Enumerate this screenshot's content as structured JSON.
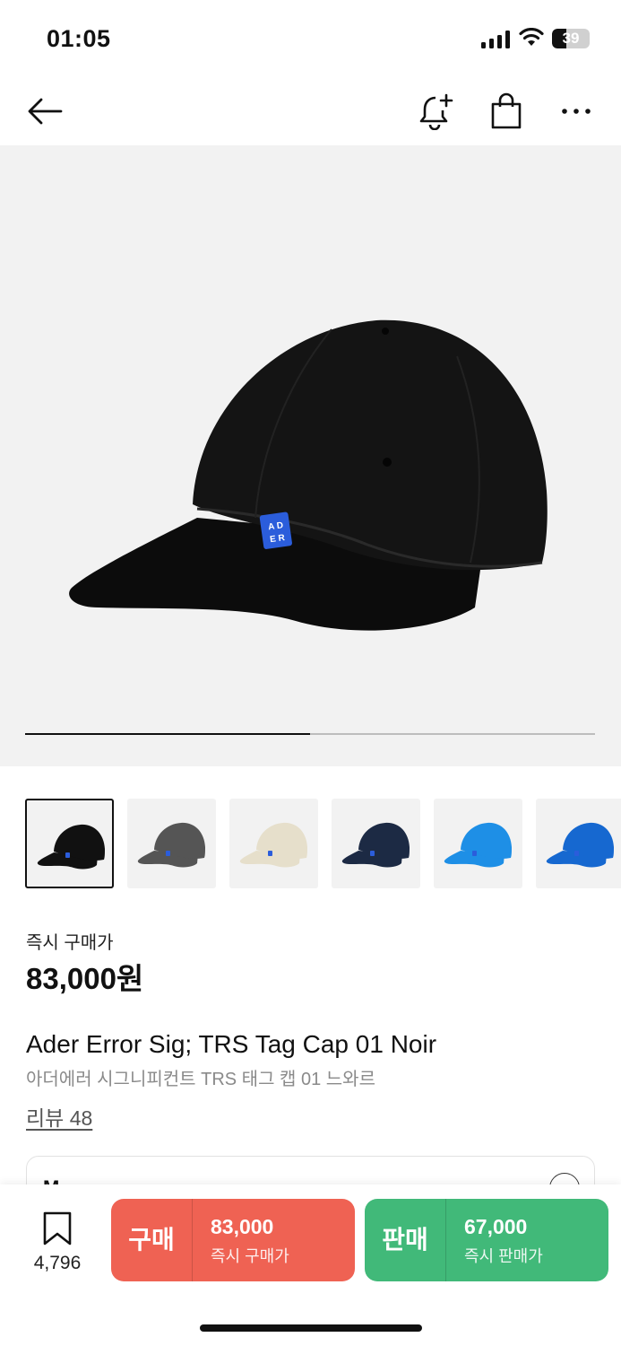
{
  "status_bar": {
    "time": "01:05",
    "battery": "39",
    "battery_level": 0.39
  },
  "nav": {
    "icons": [
      "back-arrow-icon",
      "bell-plus-icon",
      "shopping-bag-icon",
      "more-icon"
    ]
  },
  "gallery": {
    "progress": 0.5
  },
  "thumbnails": [
    {
      "name": "black",
      "color": "#111111"
    },
    {
      "name": "charcoal",
      "color": "#555555"
    },
    {
      "name": "beige",
      "color": "#e6dfcb"
    },
    {
      "name": "navy",
      "color": "#1c2a44"
    },
    {
      "name": "sky-blue",
      "color": "#1e8fe6"
    },
    {
      "name": "blue",
      "color": "#1668d0"
    }
  ],
  "product": {
    "price_label": "즉시 구매가",
    "price": "83,000원",
    "title_en": "Ader Error Sig; TRS Tag Cap 01 Noir",
    "title_ko": "아더에러 시그니피컨트 TRS 태그 캡 01 느와르",
    "review": "리뷰 48",
    "size": "M"
  },
  "bottom": {
    "wish_count": "4,796",
    "buy": {
      "label": "구매",
      "price": "83,000",
      "sub": "즉시 구매가",
      "color": "#ef6253"
    },
    "sell": {
      "label": "판매",
      "price": "67,000",
      "sub": "즉시 판매가",
      "color": "#41b979"
    }
  }
}
